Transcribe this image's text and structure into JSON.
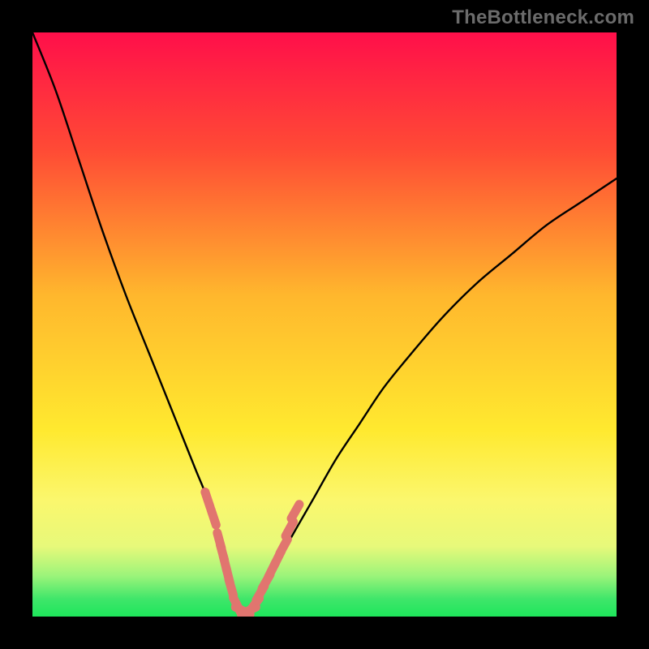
{
  "watermark": "TheBottleneck.com",
  "colors": {
    "black": "#000000",
    "curve": "#000000",
    "markers": "#e1756f",
    "green": "#1ee65b",
    "yellow": "#ffe000",
    "orange": "#ff9a2c",
    "red": "#ff1744",
    "magenta": "#ff0f4a"
  },
  "chart_data": {
    "type": "line",
    "title": "",
    "xlabel": "",
    "ylabel": "",
    "xlim": [
      0,
      100
    ],
    "ylim": [
      0,
      100
    ],
    "grid": false,
    "legend": false,
    "series": [
      {
        "name": "bottleneck-curve",
        "x": [
          0,
          4,
          8,
          12,
          16,
          20,
          24,
          26,
          28,
          30,
          32,
          33,
          34,
          35,
          36,
          37,
          38,
          40,
          42,
          44,
          48,
          52,
          56,
          60,
          64,
          70,
          76,
          82,
          88,
          94,
          100
        ],
        "y": [
          100,
          90,
          78,
          66,
          55,
          45,
          35,
          30,
          25,
          20,
          13,
          9,
          5,
          2,
          1,
          1,
          2,
          5,
          9,
          13,
          20,
          27,
          33,
          39,
          44,
          51,
          57,
          62,
          67,
          71,
          75
        ]
      }
    ],
    "markers": [
      {
        "name": "left-cluster",
        "x": [
          30,
          31,
          32,
          32.5,
          33,
          33.5
        ],
        "y": [
          20,
          17,
          13,
          11,
          9,
          7
        ]
      },
      {
        "name": "bottom-cluster",
        "x": [
          34,
          35,
          36,
          37,
          38
        ],
        "y": [
          5,
          2,
          1,
          1,
          2
        ]
      },
      {
        "name": "right-cluster",
        "x": [
          39,
          40,
          41,
          42,
          43,
          44,
          45
        ],
        "y": [
          4,
          6,
          8,
          10,
          12,
          15,
          18
        ]
      }
    ],
    "background_gradient_stops": [
      {
        "offset": 0.0,
        "color": "#ff0f4a"
      },
      {
        "offset": 0.2,
        "color": "#ff4a35"
      },
      {
        "offset": 0.45,
        "color": "#ffb72d"
      },
      {
        "offset": 0.68,
        "color": "#ffe92f"
      },
      {
        "offset": 0.8,
        "color": "#fbf76d"
      },
      {
        "offset": 0.88,
        "color": "#e7f97a"
      },
      {
        "offset": 0.93,
        "color": "#9cf47a"
      },
      {
        "offset": 0.97,
        "color": "#3fe66a"
      },
      {
        "offset": 1.0,
        "color": "#1ee65b"
      }
    ]
  }
}
